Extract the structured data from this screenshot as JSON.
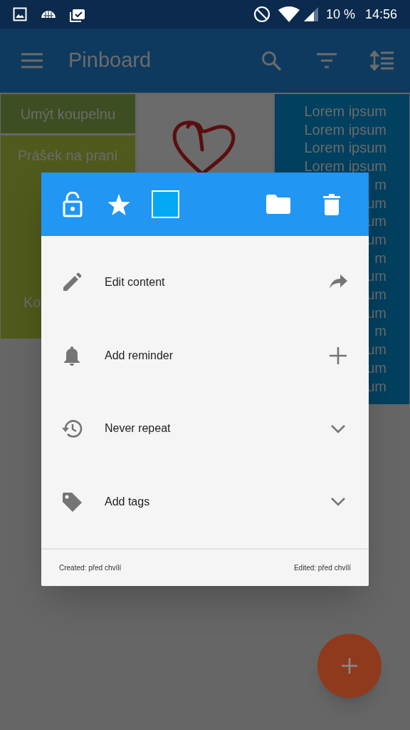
{
  "status_bar": {
    "battery": "10 %",
    "time": "14:56"
  },
  "app_bar": {
    "title": "Pinboard"
  },
  "columns": [
    {
      "notes": [
        {
          "kind": "text",
          "color": "#3d4f22",
          "lines": [
            "Umýt koupelnu"
          ]
        },
        {
          "kind": "text",
          "color": "#4f5a1c",
          "lines": [
            "Prášek na praní",
            "Ko"
          ]
        }
      ]
    },
    {
      "notes": [
        {
          "kind": "drawing",
          "color": "#6b6b6b"
        }
      ]
    },
    {
      "notes": [
        {
          "kind": "text",
          "color": "#02405f",
          "lines": [
            "Lorem ipsum",
            "Lorem ipsum",
            "Lorem ipsum",
            "Lorem ipsum",
            "m",
            "um",
            "um",
            "um",
            "m",
            "um",
            "um",
            "um",
            "m",
            "um",
            "um",
            "um"
          ]
        }
      ]
    }
  ],
  "dialog": {
    "color": "#03a9f4",
    "actions": [
      {
        "kind": "edit",
        "label": "Edit content",
        "trailing": {
          "kind": "forward"
        }
      },
      {
        "kind": "reminder",
        "label": "Add reminder",
        "trailing": {
          "kind": "plus"
        }
      },
      {
        "kind": "repeat",
        "label": "Never repeat",
        "trailing": {
          "kind": "chevron"
        }
      },
      {
        "kind": "tags",
        "label": "Add tags",
        "trailing": {
          "kind": "chevron"
        }
      }
    ],
    "created": "Created: před chvílí",
    "edited": "Edited: před chvílí"
  }
}
